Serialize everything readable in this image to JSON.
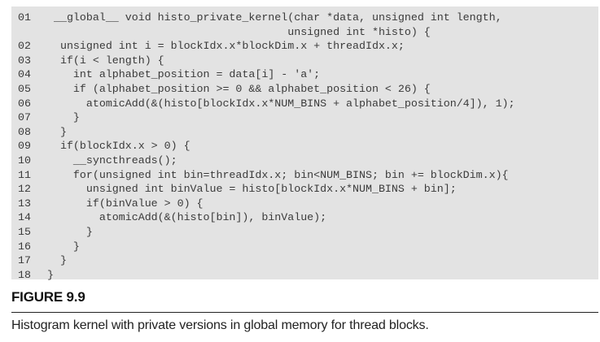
{
  "code": {
    "lines": [
      {
        "num": "01",
        "text": " __global__ void histo_private_kernel(char *data, unsigned int length,"
      },
      {
        "num": "",
        "text": "                                     unsigned int *histo) {"
      },
      {
        "num": "02",
        "text": "  unsigned int i = blockIdx.x*blockDim.x + threadIdx.x;"
      },
      {
        "num": "03",
        "text": "  if(i < length) {"
      },
      {
        "num": "04",
        "text": "    int alphabet_position = data[i] - 'a';"
      },
      {
        "num": "05",
        "text": "    if (alphabet_position >= 0 && alphabet_position < 26) {"
      },
      {
        "num": "06",
        "text": "      atomicAdd(&(histo[blockIdx.x*NUM_BINS + alphabet_position/4]), 1);"
      },
      {
        "num": "07",
        "text": "    }"
      },
      {
        "num": "08",
        "text": "  }"
      },
      {
        "num": "09",
        "text": "  if(blockIdx.x > 0) {"
      },
      {
        "num": "10",
        "text": "    __syncthreads();"
      },
      {
        "num": "11",
        "text": "    for(unsigned int bin=threadIdx.x; bin<NUM_BINS; bin += blockDim.x){"
      },
      {
        "num": "12",
        "text": "      unsigned int binValue = histo[blockIdx.x*NUM_BINS + bin];"
      },
      {
        "num": "13",
        "text": "      if(binValue > 0) {"
      },
      {
        "num": "14",
        "text": "        atomicAdd(&(histo[bin]), binValue);"
      },
      {
        "num": "15",
        "text": "      }"
      },
      {
        "num": "16",
        "text": "    }"
      },
      {
        "num": "17",
        "text": "  }"
      },
      {
        "num": "18",
        "text": "}"
      }
    ]
  },
  "figure": {
    "label": "FIGURE 9.9",
    "caption": "Histogram kernel with private versions in global memory for thread blocks."
  }
}
